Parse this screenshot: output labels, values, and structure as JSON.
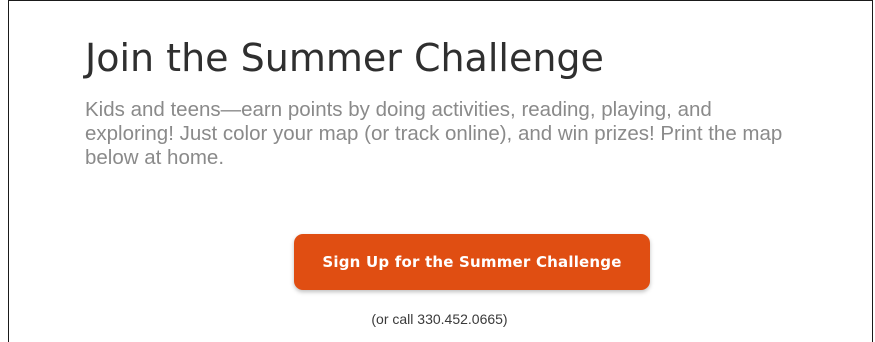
{
  "section": {
    "title": "Join the Summer Challenge",
    "description_lines": [
      "Kids and teens—earn points by doing activities, reading, playing, and",
      "exploring!  Just color your map (or track online), and win prizes! Print the map",
      "below at home."
    ],
    "signup_button_label": "Sign Up for the Summer Challenge",
    "call_text": "(or call 330.452.0665)"
  },
  "colors": {
    "accent": "#e04e12",
    "title_text": "#2f2f2f",
    "body_text": "#8a8a8a"
  }
}
